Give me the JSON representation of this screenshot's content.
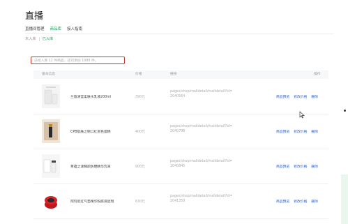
{
  "header": {
    "title": "直播"
  },
  "nav_tabs": [
    {
      "label": "直播间管理"
    },
    {
      "label": "商品库"
    },
    {
      "label": "接入指南"
    }
  ],
  "sub_tabs": [
    {
      "label": "未入库"
    },
    {
      "label": "已入库"
    }
  ],
  "notice": "已经入库 12 件商品，还可添加 1988 件。",
  "table": {
    "columns": [
      {
        "label": "基本信息"
      },
      {
        "label": "价格"
      },
      {
        "label": "链接"
      },
      {
        "label": "操作"
      }
    ],
    "rows": [
      {
        "name": "兰蔻清莹柔肤水乳液200ml",
        "price": "390元",
        "link": "pages/shop/malldetail/malldetail?id=2040564"
      },
      {
        "name": "CPB肌肤之钥口红唇色蛋糕",
        "price": "400元",
        "link": "pages/shop/malldetail/malldetail?id=2040798"
      },
      {
        "name": "菁蕴之谜臻颜防晒精华乳液",
        "price": "900元",
        "link": "pages/shop/malldetail/malldetail?id=2040845"
      },
      {
        "name": "阿玛尼红气垫精华粉底液遮瑕",
        "price": "630元",
        "link": "pages/shop/malldetail/malldetail?id=2041350"
      }
    ],
    "actions": {
      "preview": "商品预览",
      "edit_price": "修改价格",
      "delete": "删除"
    }
  },
  "colors": {
    "accent": "#18a058",
    "link": "#2a62c9",
    "highlight": "#c0392b"
  }
}
